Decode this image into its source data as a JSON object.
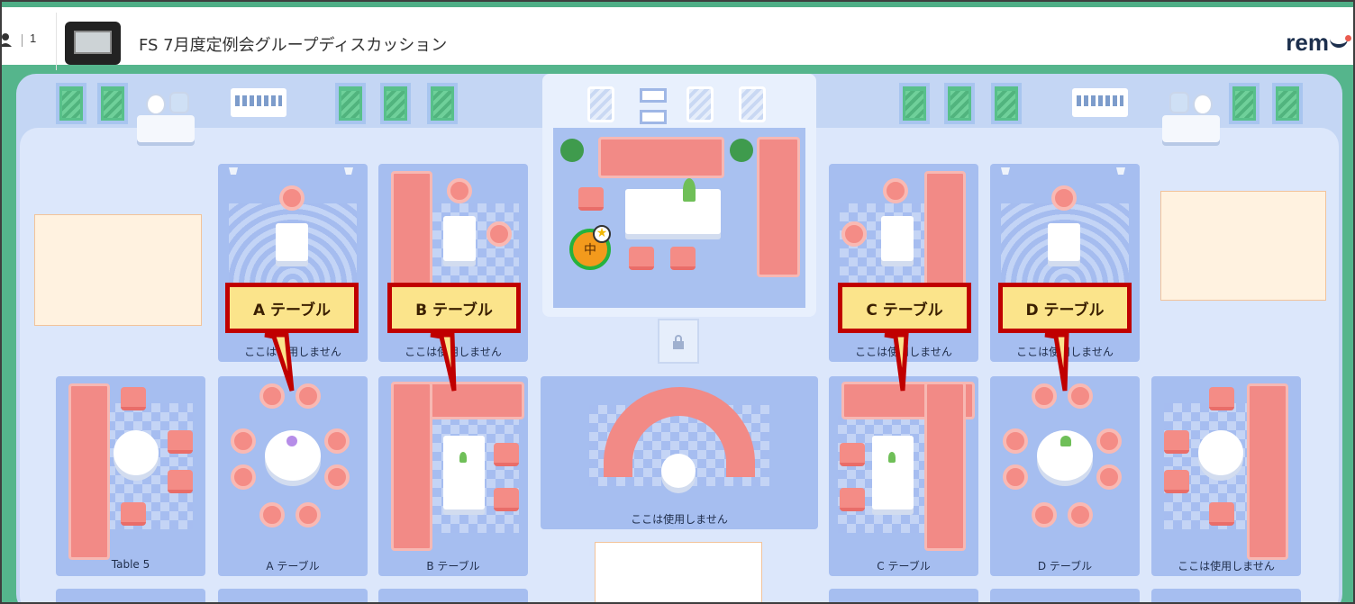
{
  "header": {
    "participant_count": "1",
    "event_title": "FS 7月度定例会グループディスカッション",
    "logo_text": "rem"
  },
  "avatar": {
    "label": "中"
  },
  "tables": {
    "row1": [
      {
        "label": "ここは使用しません"
      },
      {
        "label": "ここは使用しません"
      },
      {
        "label": "ここは使用しません"
      },
      {
        "label": "ここは使用しません"
      }
    ],
    "lounge_bottom": {
      "label": "ここは使用しません"
    },
    "row2": [
      {
        "label": "Table 5"
      },
      {
        "label": "A テーブル"
      },
      {
        "label": "B テーブル"
      },
      {
        "label": "C テーブル"
      },
      {
        "label": "D テーブル"
      },
      {
        "label": "ここは使用しません"
      }
    ]
  },
  "callouts": [
    {
      "text": "A テーブル"
    },
    {
      "text": "B テーブル"
    },
    {
      "text": "C テーブル"
    },
    {
      "text": "D テーブル"
    }
  ],
  "colors": {
    "brand_green": "#4fae86",
    "floor": "#dce7fb",
    "table_panel": "#a6bef0",
    "sofa": "#f28a86",
    "callout_fill": "#fbe48b",
    "callout_border": "#c00000"
  },
  "icons": [
    "user-icon",
    "lock-icon",
    "star-icon",
    "remo-logo"
  ]
}
